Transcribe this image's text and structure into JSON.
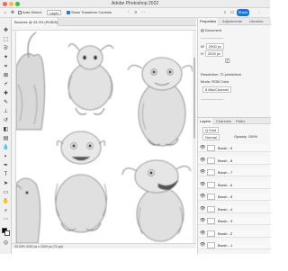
{
  "app": {
    "title": "Adobe Photoshop 2022"
  },
  "options_bar": {
    "auto_select_label": "Auto-Select:",
    "auto_select_value": "Layer",
    "transform_label": "Show Transform Controls",
    "share_label": "Share"
  },
  "document": {
    "tab_label": "Brushes @ 33.3% (RGB/8) *",
    "status": "33.33%    2000 px x 2000 px (72 ppi)"
  },
  "properties": {
    "tabs": [
      "Properties",
      "Adjustments",
      "Libraries"
    ],
    "section": "Document",
    "width_label": "W",
    "width_value": "2000 px",
    "height_label": "H",
    "height_value": "2000 px",
    "resolution": "Resolution: 72 pixels/inch",
    "mode": "Mode: RGB Color",
    "depth": "8 Bits/Channel"
  },
  "layers": {
    "tabs": [
      "Layers",
      "Channels",
      "Paths"
    ],
    "search_placeholder": "Q Kind",
    "blend": "Normal",
    "opacity": "Opacity: 100%",
    "items": [
      {
        "name": "Brush - 9"
      },
      {
        "name": "Brush - 8"
      },
      {
        "name": "Brush - 7"
      },
      {
        "name": "Brush - 6"
      },
      {
        "name": "Brush - 5"
      },
      {
        "name": "Brush - 4"
      },
      {
        "name": "Brush - 3"
      },
      {
        "name": "Brush - 2"
      },
      {
        "name": "Brush - 1"
      }
    ]
  },
  "colors": {
    "accent": "#1473e6",
    "foreground": "#000000",
    "background": "#ffffff"
  }
}
